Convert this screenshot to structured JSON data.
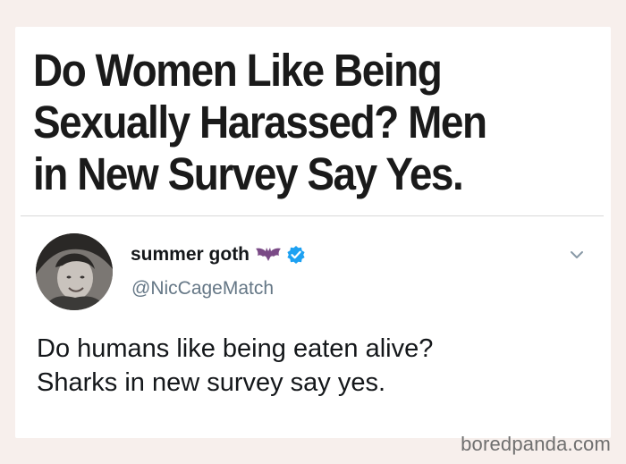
{
  "headline": {
    "text": "Do Women Like Being\nSexually Harassed? Men\nin New Survey Say Yes."
  },
  "tweet": {
    "display_name": "summer goth",
    "name_emoji": "bat-icon",
    "verified_icon": "verified-badge-icon",
    "handle": "@NicCageMatch",
    "menu_icon": "chevron-down-icon",
    "text_lines": [
      "Do humans like being eaten alive?",
      "Sharks in new survey say yes."
    ]
  },
  "watermark": {
    "text": "boredpanda.com"
  },
  "colors": {
    "background": "#f7efec",
    "card": "#ffffff",
    "verified_blue": "#1da1f2",
    "handle_gray": "#657786",
    "bat_purple": "#7a4a86"
  }
}
